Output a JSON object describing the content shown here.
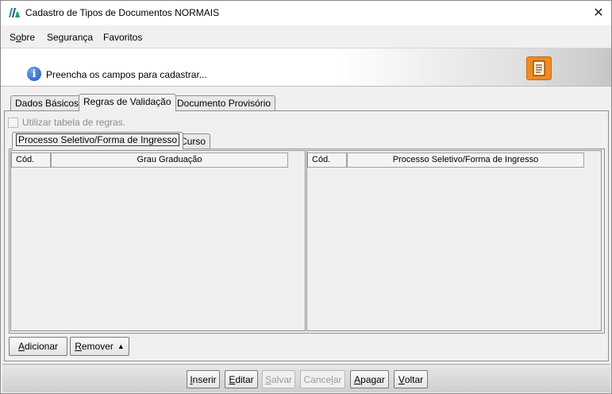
{
  "window": {
    "title": "Cadastro de Tipos de Documentos NORMAIS",
    "close_glyph": "✕"
  },
  "menu": {
    "items": [
      {
        "label": "Sobre",
        "mnemonic": "o"
      },
      {
        "label": "Segurança"
      },
      {
        "label": "Favoritos"
      }
    ]
  },
  "info": {
    "message": "Preencha os campos para cadastrar...",
    "icon": "info-icon",
    "doc_button_icon": "document-icon"
  },
  "tabs": {
    "main": [
      {
        "label": "Dados Básicos",
        "active": false
      },
      {
        "label": "Regras de Validação",
        "active": true
      },
      {
        "label": "Documento Provisório",
        "active": false
      }
    ],
    "sub": [
      {
        "label": "Processo Seletivo/Forma de Ingresso",
        "active": true
      },
      {
        "label": "Curso",
        "active": false
      }
    ]
  },
  "checkbox": {
    "label": "Utilizar tabela de regras.",
    "checked": false,
    "enabled": false
  },
  "left_table": {
    "columns": [
      "Cód.",
      "Grau Graduação"
    ],
    "rows": []
  },
  "right_table": {
    "columns": [
      "Cód.",
      "Processo Seletivo/Forma de Ingresso"
    ],
    "rows": []
  },
  "panel_buttons": {
    "add": {
      "pre": "",
      "mn": "A",
      "post": "dicionar"
    },
    "remove": {
      "pre": "",
      "mn": "R",
      "post": "emover",
      "arrow": "▲"
    }
  },
  "footer_buttons": [
    {
      "pre": "",
      "mn": "I",
      "post": "nserir",
      "enabled": true
    },
    {
      "pre": "",
      "mn": "E",
      "post": "ditar",
      "enabled": true
    },
    {
      "pre": "",
      "mn": "S",
      "post": "alvar",
      "enabled": false
    },
    {
      "pre": "Cance",
      "mn": "l",
      "post": "ar",
      "enabled": false
    },
    {
      "pre": "",
      "mn": "A",
      "post": "pagar",
      "enabled": true
    },
    {
      "pre": "",
      "mn": "V",
      "post": "oltar",
      "enabled": true
    }
  ],
  "colors": {
    "accent_orange": "#f08a24",
    "info_blue": "#1f56b8",
    "app_icon_green": "#1a9a8a"
  }
}
